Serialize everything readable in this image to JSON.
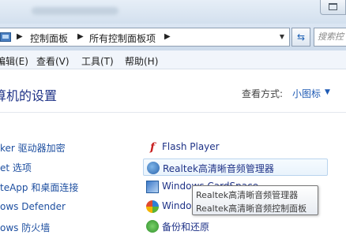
{
  "address_bar": {
    "breadcrumbs": [
      "控制面板",
      "所有控制面板项"
    ],
    "search_placeholder": "搜索控"
  },
  "menu": [
    "编辑(E)",
    "查看(V)",
    "工具(T)",
    "帮助(H)"
  ],
  "header": {
    "title": "算机的设置",
    "view_by_label": "查看方式:",
    "view_by_value": "小图标"
  },
  "left_items": [
    "ker 驱动器加密",
    "et 选项",
    "teApp 和桌面连接",
    "ows Defender",
    "ows 防火墙"
  ],
  "right_items": [
    {
      "label": "Flash Player",
      "icon": "flash-player-icon"
    },
    {
      "label": "Realtek高清晰音频管理器",
      "icon": "realtek-audio-icon"
    },
    {
      "label": "Windows CardSpace",
      "icon": "cardspace-icon"
    },
    {
      "label": "Windows Update",
      "icon": "windows-update-icon"
    },
    {
      "label": "备份和还原",
      "icon": "backup-icon"
    }
  ],
  "tooltip": [
    "Realtek高清晰音频管理器",
    "Realtek高清晰音频控制面板"
  ]
}
